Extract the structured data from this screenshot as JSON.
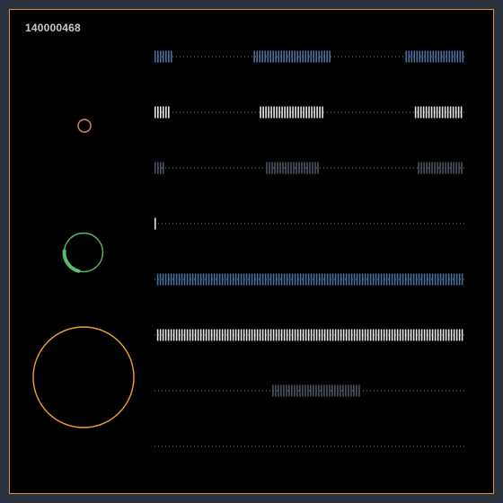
{
  "header": {
    "id_label": "140000468"
  },
  "colors": {
    "frame_border": "#d79a2a",
    "background": "#000000",
    "page_background": "#2c3440",
    "blue": "#4a6f9e",
    "white": "#e6e6e6",
    "gray": "#4a5360",
    "dots": "#8a8a8a",
    "small_circle": "#e0866e",
    "green_circle": "#5fb86a",
    "big_circle": "#f0a02e"
  },
  "circles": [
    {
      "name": "small-ring",
      "color_key": "small_circle"
    },
    {
      "name": "progress-ring",
      "color_key": "green_circle",
      "progress": 0.22
    },
    {
      "name": "large-ring",
      "color_key": "big_circle"
    }
  ],
  "tracks": [
    {
      "color_key": "blue",
      "filled_segments": [
        [
          0.0,
          0.06
        ],
        [
          0.32,
          0.57
        ],
        [
          0.81,
          1.0
        ]
      ]
    },
    {
      "color_key": "white",
      "filled_segments": [
        [
          0.0,
          0.05
        ],
        [
          0.34,
          0.55
        ],
        [
          0.84,
          1.0
        ]
      ]
    },
    {
      "color_key": "gray",
      "filled_segments": [
        [
          0.0,
          0.035
        ],
        [
          0.36,
          0.53
        ],
        [
          0.85,
          1.0
        ]
      ]
    },
    {
      "color_key": "white",
      "filled_segments": [
        [
          0.0,
          0.006
        ]
      ]
    },
    {
      "color_key": "blue",
      "filled_segments": [
        [
          0.008,
          1.0
        ]
      ]
    },
    {
      "color_key": "white",
      "filled_segments": [
        [
          0.008,
          1.0
        ]
      ]
    },
    {
      "color_key": "gray",
      "filled_segments": [
        [
          0.38,
          0.67
        ]
      ]
    },
    {
      "color_key": "gray",
      "filled_segments": []
    }
  ]
}
